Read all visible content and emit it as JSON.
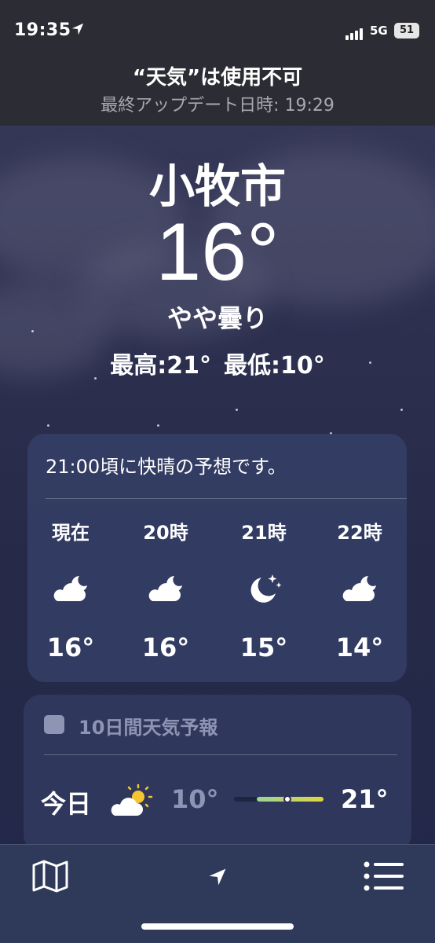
{
  "status": {
    "time": "19:35",
    "network": "5G",
    "battery": "51"
  },
  "banner": {
    "title": "“天気”は使用不可",
    "subtitle": "最終アップデート日時: 19:29"
  },
  "current": {
    "city": "小牧市",
    "temperature": "16°",
    "condition": "やや曇り",
    "high": "最高:21°",
    "low": "最低:10°"
  },
  "hourly": {
    "message": "21:00頃に快晴の予想です。",
    "items": [
      {
        "label": "現在",
        "icon": "partly-cloudy-night-icon",
        "temp": "16°"
      },
      {
        "label": "20時",
        "icon": "partly-cloudy-night-icon",
        "temp": "16°"
      },
      {
        "label": "21時",
        "icon": "clear-night-icon",
        "temp": "15°"
      },
      {
        "label": "22時",
        "icon": "partly-cloudy-night-icon",
        "temp": "14°"
      }
    ]
  },
  "daily": {
    "title": "10日間天気予報",
    "rows": [
      {
        "day": "今日",
        "icon": "partly-sunny-icon",
        "low": "10°",
        "high": "21°",
        "range_start": 0.25,
        "range_end": 1.0,
        "current": 0.6
      }
    ]
  },
  "tabbar": {
    "icons": [
      "map-icon",
      "location-arrow-icon",
      "list-icon"
    ]
  }
}
